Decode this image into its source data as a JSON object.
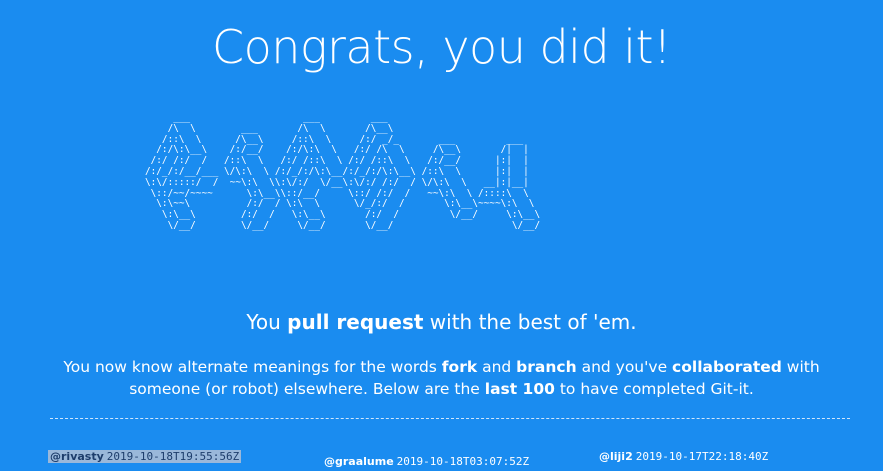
{
  "page": {
    "title": "Congrats, you did it!",
    "ascii_art": "     ___                    ___         ___                    \n    /\\  \\        ___       /\\  \\       /\\__\\                    \n   /::\\  \\      /\\__\\     /::\\  \\     /:/ _/_       ___         ___    \n  /:/\\:\\__\\    /:/__/    /:/\\:\\  \\   /:/ /\\  \\     /\\__\\       /|  |   \n /:/ /:/  /   /::\\  \\   /:/ /::\\  \\ /:/ /::\\  \\   /:/__/      |:|  |   \n/:/_/:/__/___ \\/\\:\\  \\ /:/_/:/\\:\\__/:/_/:/\\:\\__\\ /::\\  \\      |:|  |   \n\\:\\/:::::/  /  ~~\\:\\  \\\\:\\/:/  \\/__\\:\\/:/ /:/  / \\/\\:\\  \\   __|:|__|   \n \\::/~~/~~~~      \\:\\__\\\\::/__/     \\::/ /:/  /   ~~\\:\\  \\ /::::\\  \\   \n  \\:\\~~\\          /:/  / \\:\\  \\      \\/_/:/  /       \\:\\__\\~~~~\\:\\  \\  \n   \\:\\__\\        /:/  /   \\:\\__\\       /:/  /         \\/__/     \\:\\__\\ \n    \\/__/        \\/__/     \\/__/       \\/__/                     \\/__/ ",
    "tagline": {
      "before": "You ",
      "bold1": "pull request",
      "after": " with the best of 'em."
    },
    "message": {
      "p1": "You now know alternate meanings for the words ",
      "b1": "fork",
      "p2": " and ",
      "b2": "branch",
      "p3": " and you've ",
      "b3": "collaborated",
      "p4": " with someone (or robot) elsewhere. Below are the ",
      "b4": "last 100",
      "p5": " to have completed Git-it."
    },
    "completers": [
      {
        "user": "@rivasty",
        "timestamp": "2019-10-18T19:55:56Z"
      },
      {
        "user": "@graalume",
        "timestamp": "2019-10-18T03:07:52Z"
      },
      {
        "user": "@liji2",
        "timestamp": "2019-10-17T22:18:40Z"
      }
    ]
  },
  "colors": {
    "background": "#1a8cf0",
    "text": "#ffffff",
    "highlight": "#9ab8da"
  }
}
